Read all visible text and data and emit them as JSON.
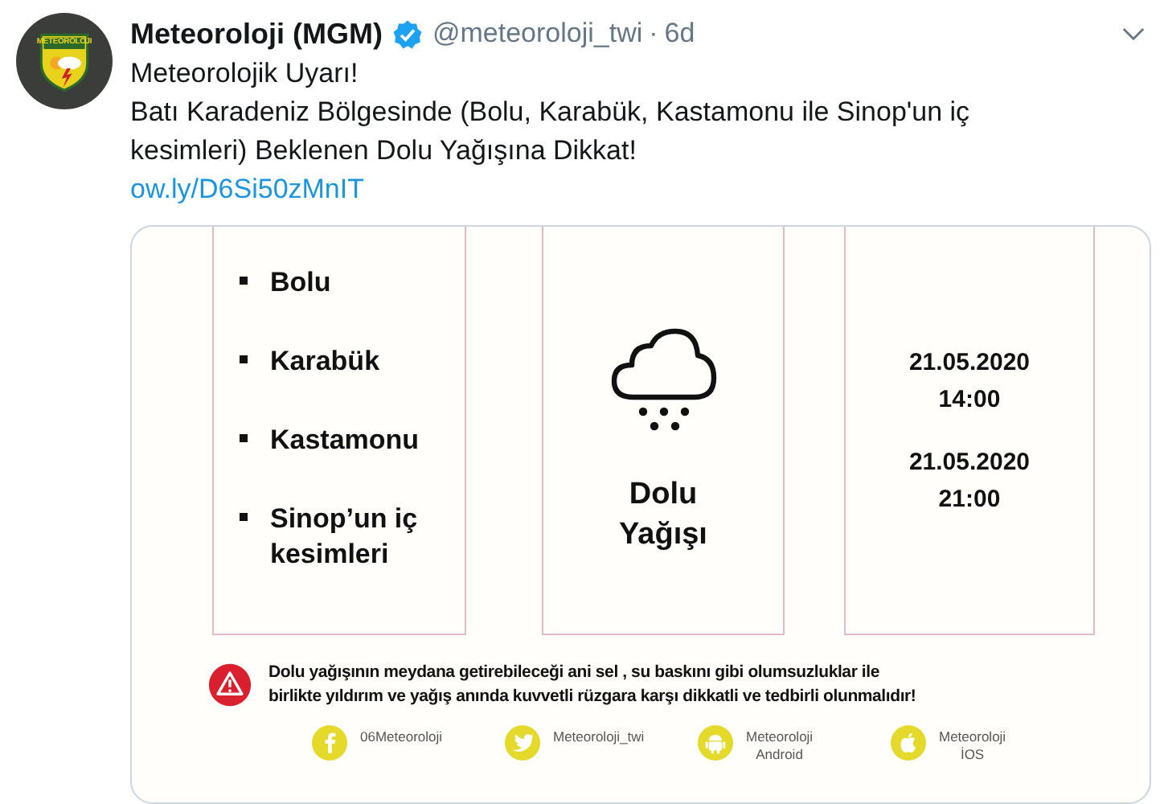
{
  "tweet": {
    "avatar_label": "METEOROLOJI",
    "author": "Meteoroloji (MGM)",
    "verified": true,
    "handle": "@meteoroloji_twi",
    "separator": "·",
    "time": "6d",
    "text": [
      "Meteorolojik Uyarı!",
      "Batı Karadeniz Bölgesinde (Bolu, Karabük, Kastamonu ile Sinop'un iç kesimleri) Beklenen Dolu Yağışına Dikkat!"
    ],
    "link": "ow.ly/D6Si50zMnIT"
  },
  "card": {
    "regions": [
      "Bolu",
      "Karabük",
      "Kastamonu",
      "Sinop’un iç kesimleri"
    ],
    "event": [
      "Dolu",
      "Yağışı"
    ],
    "periods": [
      {
        "date": "21.05.2020",
        "time": "14:00"
      },
      {
        "date": "21.05.2020",
        "time": "21:00"
      }
    ],
    "warning": [
      "Dolu yağışının meydana getirebileceği  ani sel , su baskını  gibi olumsuzluklar ile",
      "birlikte yıldırım ve yağış anında kuvvetli rüzgara karşı dikkatli ve tedbirli olunmalıdır!"
    ],
    "socials": [
      {
        "kind": "facebook",
        "label": [
          "06Meteoroloji"
        ]
      },
      {
        "kind": "twitter",
        "label": [
          "Meteoroloji_twi"
        ]
      },
      {
        "kind": "android",
        "label": [
          "Meteoroloji",
          "Android"
        ]
      },
      {
        "kind": "apple",
        "label": [
          "Meteoroloji",
          "İOS"
        ]
      }
    ]
  }
}
